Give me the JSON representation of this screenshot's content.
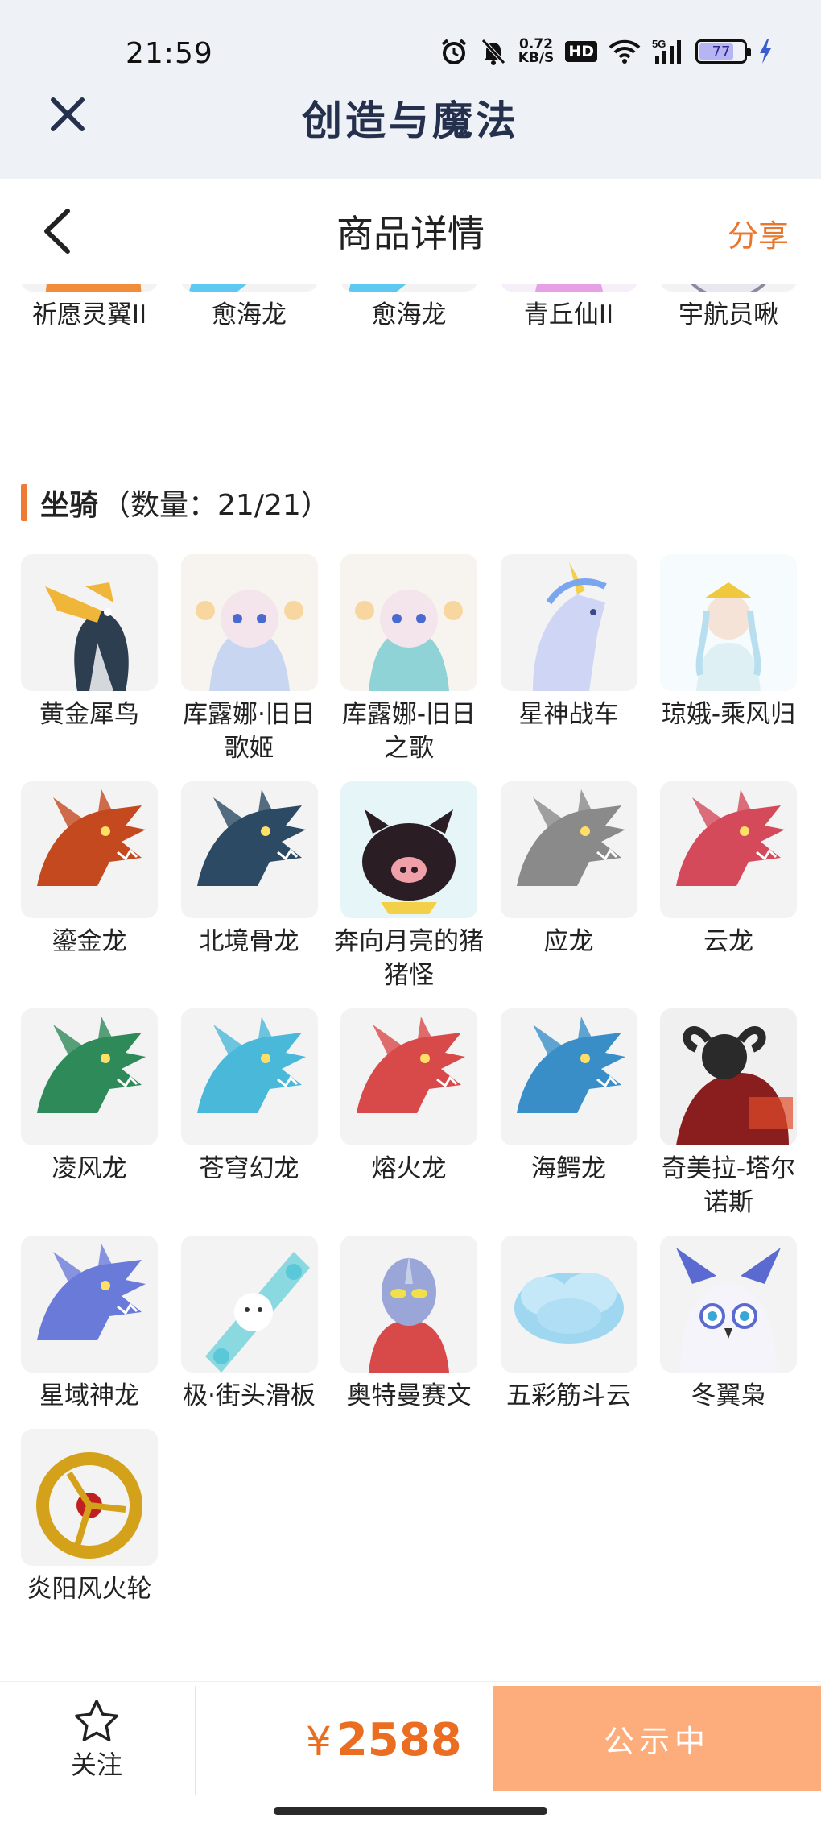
{
  "status_bar": {
    "time": "21:59",
    "net_speed": "0.72",
    "net_unit": "KB/S",
    "hd": "HD",
    "network": "5G",
    "battery": "77",
    "battery_level_percent": 77
  },
  "app_header": {
    "title": "创造与魔法"
  },
  "page_header": {
    "title": "商品详情",
    "share": "分享"
  },
  "top_items": [
    {
      "name": "祈愿灵翼II",
      "icon": "phoenix-icon",
      "color": "#f08c3a"
    },
    {
      "name": "愈海龙",
      "icon": "sea-dragon-icon",
      "color": "#5ec8f0"
    },
    {
      "name": "愈海龙",
      "icon": "sea-dragon-icon",
      "color": "#5ec8f0"
    },
    {
      "name": "青丘仙II",
      "icon": "fox-fairy-icon",
      "color": "#e6a0e6"
    },
    {
      "name": "宇航员啾",
      "icon": "astronaut-icon",
      "color": "#e8e8f0"
    }
  ],
  "mounts_section": {
    "label": "坐骑",
    "count": "（数量：21/21）"
  },
  "mounts": [
    {
      "name": "黄金犀鸟",
      "icon": "hornbill-icon",
      "color": "#f0b63a"
    },
    {
      "name": "库露娜·旧日歌姬",
      "icon": "idol-icon",
      "color": "#c8d6f2"
    },
    {
      "name": "库露娜-旧日之歌",
      "icon": "idol-icon",
      "color": "#8fd3d6"
    },
    {
      "name": "星神战车",
      "icon": "unicorn-icon",
      "color": "#cfd6f5"
    },
    {
      "name": "琼娥-乘风归",
      "icon": "goddess-icon",
      "color": "#dff0f5"
    },
    {
      "name": "鎏金龙",
      "icon": "dragon-icon",
      "color": "#c4491f"
    },
    {
      "name": "北境骨龙",
      "icon": "dragon-icon",
      "color": "#2c4a63"
    },
    {
      "name": "奔向月亮的猪猪怪",
      "icon": "pig-icon",
      "color": "#2a1e24"
    },
    {
      "name": "应龙",
      "icon": "dragon-icon",
      "color": "#8a8a8a"
    },
    {
      "name": "云龙",
      "icon": "dragon-icon",
      "color": "#d44a5a"
    },
    {
      "name": "凌风龙",
      "icon": "dragon-icon",
      "color": "#2f8a5a"
    },
    {
      "name": "苍穹幻龙",
      "icon": "dragon-icon",
      "color": "#4ab8d8"
    },
    {
      "name": "熔火龙",
      "icon": "dragon-icon",
      "color": "#d84a4a"
    },
    {
      "name": "海鳄龙",
      "icon": "dragon-icon",
      "color": "#3a8ec8"
    },
    {
      "name": "奇美拉-塔尔诺斯",
      "icon": "chimera-icon",
      "color": "#8a1e1e"
    },
    {
      "name": "星域神龙",
      "icon": "dragon-icon",
      "color": "#6a7ad8"
    },
    {
      "name": "极·街头滑板",
      "icon": "skateboard-icon",
      "color": "#8ad8e0"
    },
    {
      "name": "奥特曼赛文",
      "icon": "hero-icon",
      "color": "#9aa6d8"
    },
    {
      "name": "五彩筋斗云",
      "icon": "cloud-icon",
      "color": "#9fd6f0"
    },
    {
      "name": "冬翼枭",
      "icon": "owl-icon",
      "color": "#5a6ad0"
    },
    {
      "name": "炎阳风火轮",
      "icon": "fire-wheel-icon",
      "color": "#d4a21a"
    }
  ],
  "bottom_bar": {
    "follow_label": "关注",
    "currency": "¥",
    "price": "2588",
    "status_button": "公示中"
  }
}
